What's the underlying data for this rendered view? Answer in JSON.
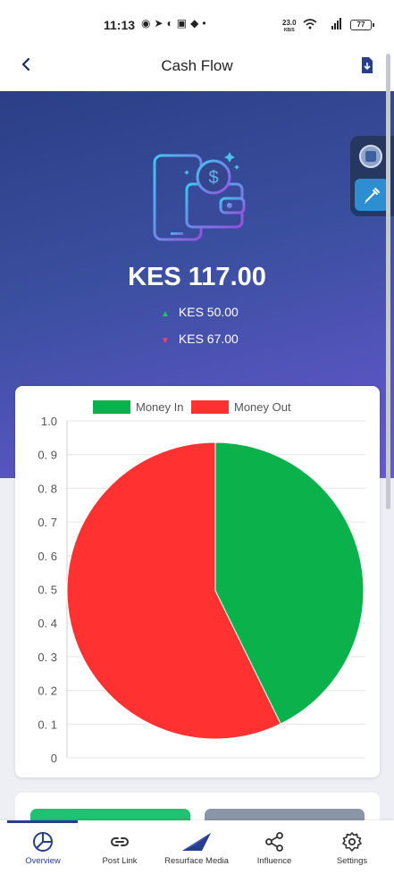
{
  "status_bar": {
    "time": "11:13",
    "network_speed": "23.0",
    "network_speed_unit": "KB/S",
    "battery": "77"
  },
  "app_bar": {
    "title": "Cash Flow",
    "back_icon": "back-arrow-icon",
    "action_icon": "download-icon"
  },
  "summary": {
    "balance": "KES 117.00",
    "money_in": "KES 50.00",
    "money_out": "KES 67.00"
  },
  "chart_data": {
    "type": "pie",
    "labels": [
      "Money In",
      "Money Out"
    ],
    "values": [
      50,
      67
    ],
    "colors": [
      "#0bb24b",
      "#ff3131"
    ],
    "legend_position": "top",
    "yaxis_ticks": [
      "1.0",
      "0. 9",
      "0. 8",
      "0. 7",
      "0. 6",
      "0. 5",
      "0. 4",
      "0. 3",
      "0. 2",
      "0. 1",
      "0"
    ],
    "grid": true
  },
  "bottom_nav": {
    "items": [
      {
        "label": "Overview",
        "icon": "pie-chart-icon",
        "active": true
      },
      {
        "label": "Post Link",
        "icon": "link-icon",
        "active": false
      },
      {
        "label": "Resurface Media",
        "icon": "paper-plane-icon",
        "active": false
      },
      {
        "label": "Influence",
        "icon": "share-icon",
        "active": false
      },
      {
        "label": "Settings",
        "icon": "gear-icon",
        "active": false
      }
    ]
  },
  "colors": {
    "hero_start": "#2b3e86",
    "hero_end": "#6858d2",
    "positive": "#22c070",
    "negative": "#ff3a6e",
    "nav_active": "#273d8f"
  }
}
